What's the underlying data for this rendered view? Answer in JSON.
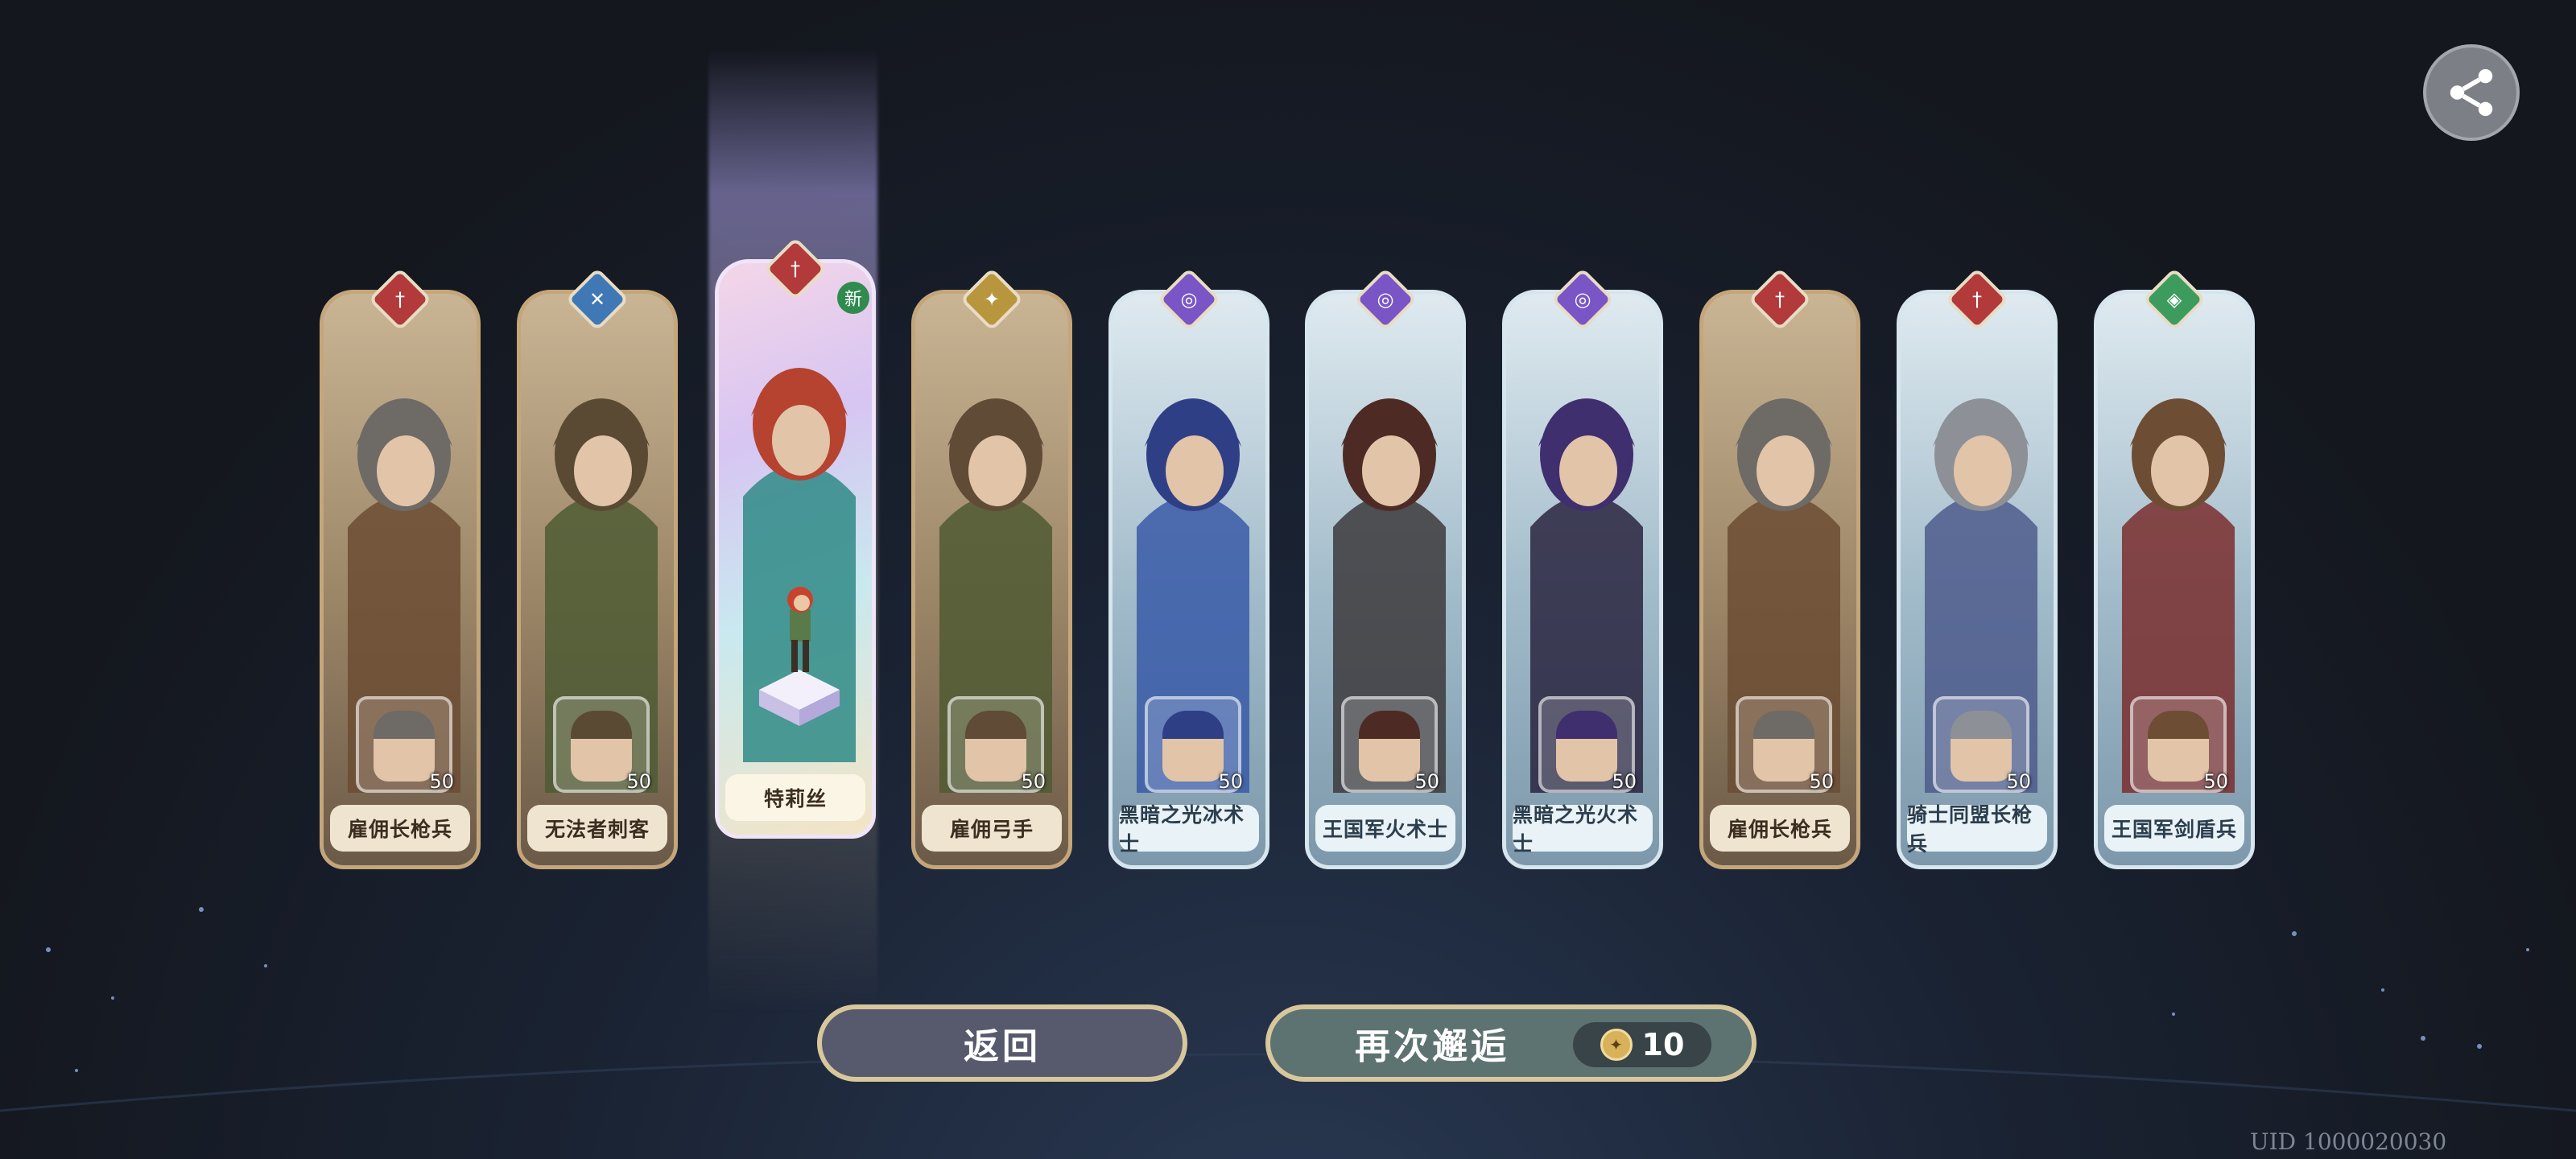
{
  "buttons": {
    "back_label": "返回",
    "again_label": "再次邂逅"
  },
  "cost": {
    "amount": "10",
    "icon": "summon-ticket-icon"
  },
  "uid_text": "UID 1000020030",
  "share_icon": "share-icon",
  "new_tag": "新",
  "cards": [
    {
      "name": "雇佣长枪兵",
      "level": "50",
      "class_icon": "spear-icon",
      "badge_color": "#b23a3a",
      "theme": "brown"
    },
    {
      "name": "无法者刺客",
      "level": "50",
      "class_icon": "assassin-icon",
      "badge_color": "#3f78b5",
      "theme": "brown"
    },
    {
      "name": "特莉丝",
      "level": "",
      "class_icon": "sword-icon",
      "badge_color": "#b23a3a",
      "theme": "rainbow",
      "is_new": true
    },
    {
      "name": "雇佣弓手",
      "level": "50",
      "class_icon": "archer-icon",
      "badge_color": "#b8963e",
      "theme": "brown"
    },
    {
      "name": "黑暗之光冰术士",
      "level": "50",
      "class_icon": "mage-icon",
      "badge_color": "#7a55c6",
      "theme": "blue"
    },
    {
      "name": "王国军火术士",
      "level": "50",
      "class_icon": "mage-icon",
      "badge_color": "#7a55c6",
      "theme": "blue"
    },
    {
      "name": "黑暗之光火术士",
      "level": "50",
      "class_icon": "mage-icon",
      "badge_color": "#7a55c6",
      "theme": "blue"
    },
    {
      "name": "雇佣长枪兵",
      "level": "50",
      "class_icon": "spear-icon",
      "badge_color": "#b23a3a",
      "theme": "brown"
    },
    {
      "name": "骑士同盟长枪兵",
      "level": "50",
      "class_icon": "spear-icon",
      "badge_color": "#b23a3a",
      "theme": "blue"
    },
    {
      "name": "王国军剑盾兵",
      "level": "50",
      "class_icon": "shield-icon",
      "badge_color": "#3e9b5e",
      "theme": "blue"
    }
  ]
}
